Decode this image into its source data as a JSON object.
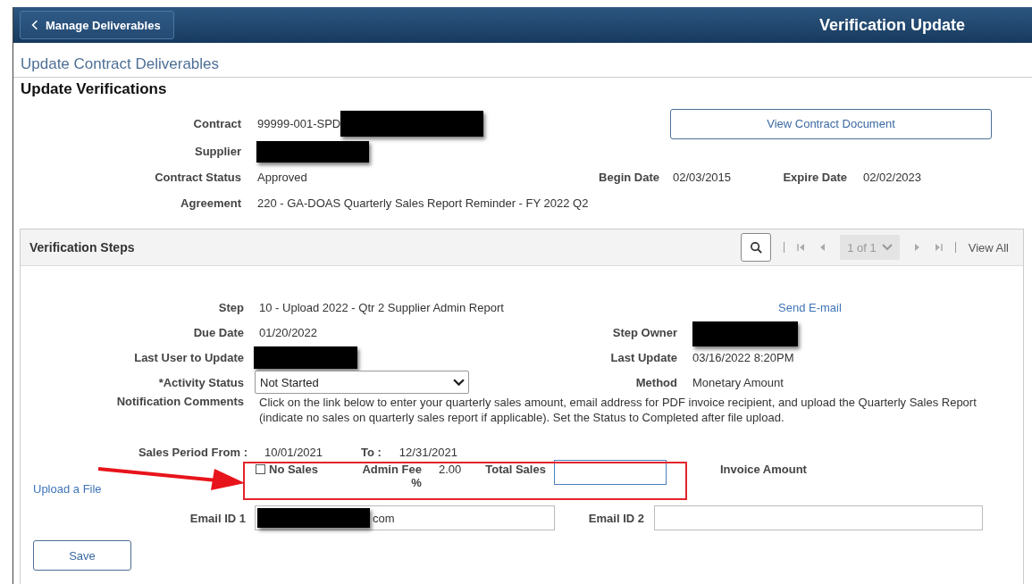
{
  "header": {
    "back_button": "Manage Deliverables",
    "title": "Verification Update"
  },
  "breadcrumb": "Update Contract Deliverables",
  "page_title": "Update Verifications",
  "contract": {
    "contract_label": "Contract",
    "contract_value": "99999-001-SPD",
    "view_button": "View Contract Document",
    "supplier_label": "Supplier",
    "status_label": "Contract Status",
    "status_value": "Approved",
    "begin_label": "Begin Date",
    "begin_value": "02/03/2015",
    "expire_label": "Expire Date",
    "expire_value": "02/02/2023",
    "agreement_label": "Agreement",
    "agreement_value": "220 - GA-DOAS Quarterly Sales Report Reminder - FY 2022 Q2"
  },
  "steps": {
    "title": "Verification Steps",
    "pager_position": "1 of 1",
    "view_all": "View All",
    "step_label": "Step",
    "step_value": "10 - Upload 2022 - Qtr 2 Supplier Admin Report",
    "send_email": "Send E-mail",
    "due_label": "Due Date",
    "due_value": "01/20/2022",
    "owner_label": "Step Owner",
    "last_user_label": "Last User to Update",
    "last_update_label": "Last Update",
    "last_update_value": "03/16/2022  8:20PM",
    "activity_label": "*Activity Status",
    "activity_value": "Not Started",
    "method_label": "Method",
    "method_value": "Monetary Amount",
    "comments_label": "Notification Comments",
    "comments_value": "Click on the link below to enter your quarterly sales amount, email address for PDF invoice recipient, and upload the Quarterly Sales Report (indicate no sales on quarterly sales report if applicable). Set the Status to Completed after file upload.",
    "period_label": "Sales Period From :",
    "period_from": "10/01/2021",
    "to_label": "To :",
    "period_to": "12/31/2021",
    "no_sales": {
      "label": "No Sales",
      "checked": false
    },
    "admin_fee_label": "Admin Fee %",
    "admin_fee_value": "2.00",
    "total_sales_label": "Total Sales",
    "invoice_label": "Invoice Amount",
    "upload_link": "Upload a File",
    "email1_label": "Email ID 1",
    "email1_value": "com",
    "email2_label": "Email ID 2",
    "save": "Save"
  }
}
